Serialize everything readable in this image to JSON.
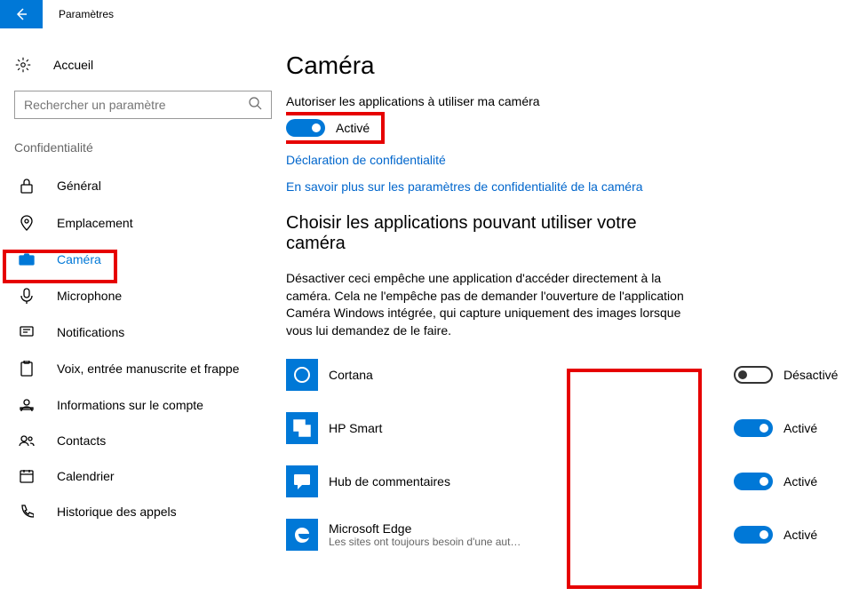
{
  "titlebar": {
    "text": "Paramètres"
  },
  "sidebar": {
    "home": "Accueil",
    "search_placeholder": "Rechercher un paramètre",
    "section_label": "Confidentialité",
    "items": [
      {
        "label": "Général"
      },
      {
        "label": "Emplacement"
      },
      {
        "label": "Caméra"
      },
      {
        "label": "Microphone"
      },
      {
        "label": "Notifications"
      },
      {
        "label": "Voix, entrée manuscrite et frappe"
      },
      {
        "label": "Informations sur le compte"
      },
      {
        "label": "Contacts"
      },
      {
        "label": "Calendrier"
      },
      {
        "label": "Historique des appels"
      }
    ]
  },
  "main": {
    "title": "Caméra",
    "allow_label": "Autoriser les applications à utiliser ma caméra",
    "main_toggle": {
      "state": "on",
      "label": "Activé"
    },
    "privacy_link": "Déclaration de confidentialité",
    "learn_link": "En savoir plus sur les paramètres de confidentialité de la caméra",
    "choose_title": "Choisir les applications pouvant utiliser votre caméra",
    "choose_desc": "Désactiver ceci empêche une application d'accéder directement à la caméra. Cela ne l'empêche pas de demander l'ouverture de l'application Caméra Windows intégrée, qui capture uniquement des images lorsque vous lui demandez de le faire.",
    "apps": [
      {
        "name": "Cortana",
        "sub": "",
        "state": "off",
        "label": "Désactivé"
      },
      {
        "name": "HP Smart",
        "sub": "",
        "state": "on",
        "label": "Activé"
      },
      {
        "name": "Hub de commentaires",
        "sub": "",
        "state": "on",
        "label": "Activé"
      },
      {
        "name": "Microsoft Edge",
        "sub": "Les sites ont toujours besoin d'une aut…",
        "state": "on",
        "label": "Activé"
      }
    ]
  }
}
